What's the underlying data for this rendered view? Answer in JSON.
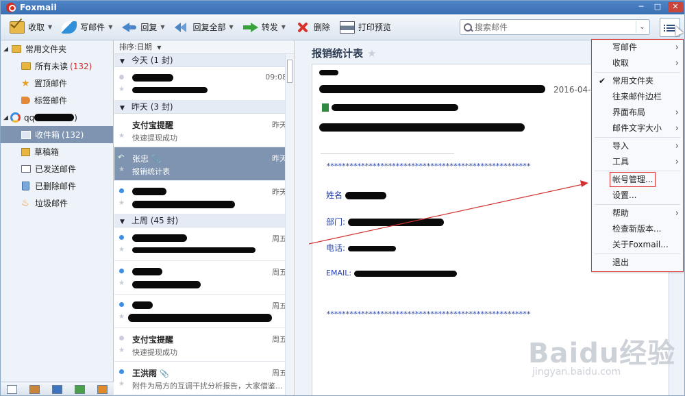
{
  "window": {
    "title": "Foxmail"
  },
  "toolbar": {
    "receive": "收取",
    "compose": "写邮件",
    "reply": "回复",
    "reply_all": "回复全部",
    "forward": "转发",
    "delete": "删除",
    "print_preview": "打印预览"
  },
  "search": {
    "placeholder": "搜索邮件"
  },
  "sidebar": {
    "common_folders": "常用文件夹",
    "all_unread": "所有未读",
    "all_unread_count": "(132)",
    "pinned": "置顶邮件",
    "tagged": "标签邮件",
    "account_prefix": "qq",
    "account_suffix": ")",
    "inbox": "收件箱",
    "inbox_count": "(132)",
    "drafts": "草稿箱",
    "sent": "已发送邮件",
    "deleted": "已删除邮件",
    "junk": "垃圾邮件"
  },
  "maillist": {
    "sort_label": "排序:日期",
    "groups": {
      "today": "今天 (1 封)",
      "yesterday": "昨天 (3 封)",
      "last_week": "上周 (45 封)"
    },
    "mails": [
      {
        "sender": "",
        "date": "09:08",
        "subject": "",
        "dot": "grey"
      },
      {
        "sender": "支付宝提醒",
        "date": "昨天",
        "subject": "快速提现成功",
        "dot": "none"
      },
      {
        "sender": "张忠",
        "date": "昨天",
        "subject": "报销统计表",
        "dot": "none"
      },
      {
        "sender": "",
        "date": "昨天",
        "subject": "",
        "dot": "blue"
      },
      {
        "sender": "",
        "date": "周五",
        "subject": "",
        "dot": "blue"
      },
      {
        "sender": "",
        "date": "周五",
        "subject": "",
        "dot": "blue"
      },
      {
        "sender": "",
        "date": "周五",
        "subject": "",
        "dot": "blue"
      },
      {
        "sender": "支付宝提醒",
        "date": "周五",
        "subject": "快速提现成功",
        "dot": "grey"
      },
      {
        "sender": "王洪雨",
        "date": "周五",
        "subject": "附件为局方的互调干扰分析报告，大家借鉴...",
        "dot": "blue"
      }
    ]
  },
  "reader": {
    "subject": "报销统计表",
    "date": "2016-04-",
    "stars_line": "*****************************************************",
    "fields": {
      "name": "姓名",
      "dept": "部门:",
      "phone": "电话:",
      "email": "EMAIL:"
    }
  },
  "menu": {
    "items": [
      {
        "label": "写邮件",
        "sub": true
      },
      {
        "label": "收取",
        "sub": true
      },
      {
        "label": "常用文件夹",
        "checked": true
      },
      {
        "label": "往来邮件边栏"
      },
      {
        "label": "界面布局",
        "sub": true
      },
      {
        "label": "邮件文字大小",
        "sub": true
      },
      {
        "label": "导入",
        "sub": true
      },
      {
        "label": "工具",
        "sub": true
      },
      {
        "label": "帐号管理..."
      },
      {
        "label": "设置..."
      },
      {
        "label": "帮助",
        "sub": true
      },
      {
        "label": "检查新版本..."
      },
      {
        "label": "关于Foxmail..."
      },
      {
        "label": "退出"
      }
    ]
  },
  "watermark": {
    "brand": "Baidu经验",
    "url": "jingyan.baidu.com"
  },
  "colors": {
    "accent": "#d33333",
    "selection": "#7e94b0",
    "title_bar": "#3a6fb2"
  }
}
